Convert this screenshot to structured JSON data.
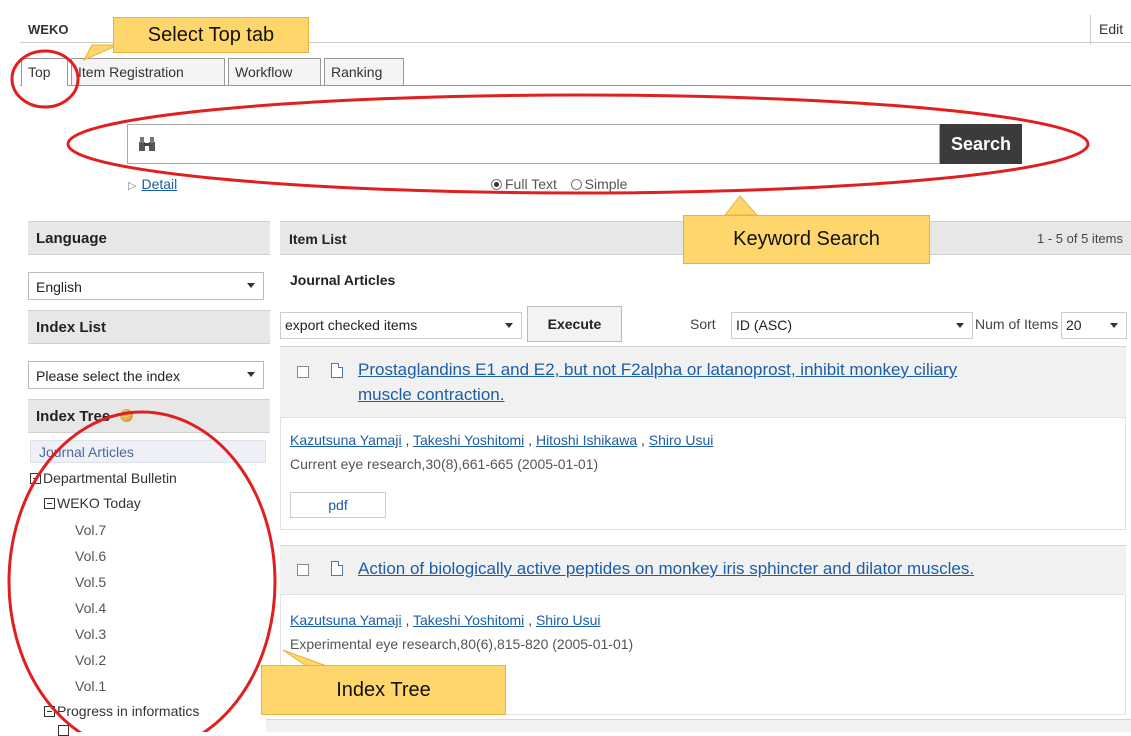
{
  "header": {
    "brand": "WEKO",
    "edit_label": "Edit"
  },
  "tabs": [
    {
      "label": "Top",
      "active": true
    },
    {
      "label": "Item Registration",
      "active": false
    },
    {
      "label": "Workflow",
      "active": false
    },
    {
      "label": "Ranking",
      "active": false
    }
  ],
  "search": {
    "button_label": "Search",
    "detail_label": "Detail",
    "mode_full": "Full Text",
    "mode_simple": "Simple",
    "selected_mode": "Full Text"
  },
  "sidebar": {
    "language_title": "Language",
    "language_value": "English",
    "index_list_title": "Index List",
    "index_list_value": "Please select the index",
    "index_tree_title": "Index Tree",
    "tree": {
      "journal": "Journal Articles",
      "departmental": "Departmental Bulletin",
      "weko_today": "WEKO Today",
      "volumes": [
        "Vol.7",
        "Vol.6",
        "Vol.5",
        "Vol.4",
        "Vol.3",
        "Vol.2",
        "Vol.1"
      ],
      "progress": "Progress in informatics"
    }
  },
  "main": {
    "title": "Item List",
    "count": "1 - 5 of 5 items",
    "subtitle": "Journal Articles",
    "export_value": "export checked items",
    "execute_label": "Execute",
    "sort_label": "Sort",
    "sort_value": "ID (ASC)",
    "num_label": "Num of Items",
    "num_value": "20",
    "items": [
      {
        "title_line1": "Prostaglandins E1 and E2, but not F2alpha or latanoprost, inhibit monkey ciliary",
        "title_line2": "muscle contraction.",
        "authors": [
          "Kazutsuna Yamaji",
          "Takeshi Yoshitomi",
          "Hitoshi Ishikawa",
          "Shiro Usui"
        ],
        "citation": "Current eye research,30(8),661-665 (2005-01-01)",
        "file": "pdf"
      },
      {
        "title_line1": "Action of biologically active peptides on monkey iris sphincter and dilator muscles.",
        "authors": [
          "Kazutsuna Yamaji",
          "Takeshi Yoshitomi",
          "Shiro Usui"
        ],
        "citation": "Experimental eye research,80(6),815-820 (2005-01-01)"
      }
    ]
  },
  "annotations": {
    "select_top": "Select Top tab",
    "keyword_search": "Keyword Search",
    "index_tree": "Index Tree",
    "highlight_color": "#e02020",
    "callout_color": "#ffd66b"
  },
  "icons": {
    "search_field": "binoculars-icon",
    "index_tree": "tree-icon",
    "item": "document-icon"
  }
}
